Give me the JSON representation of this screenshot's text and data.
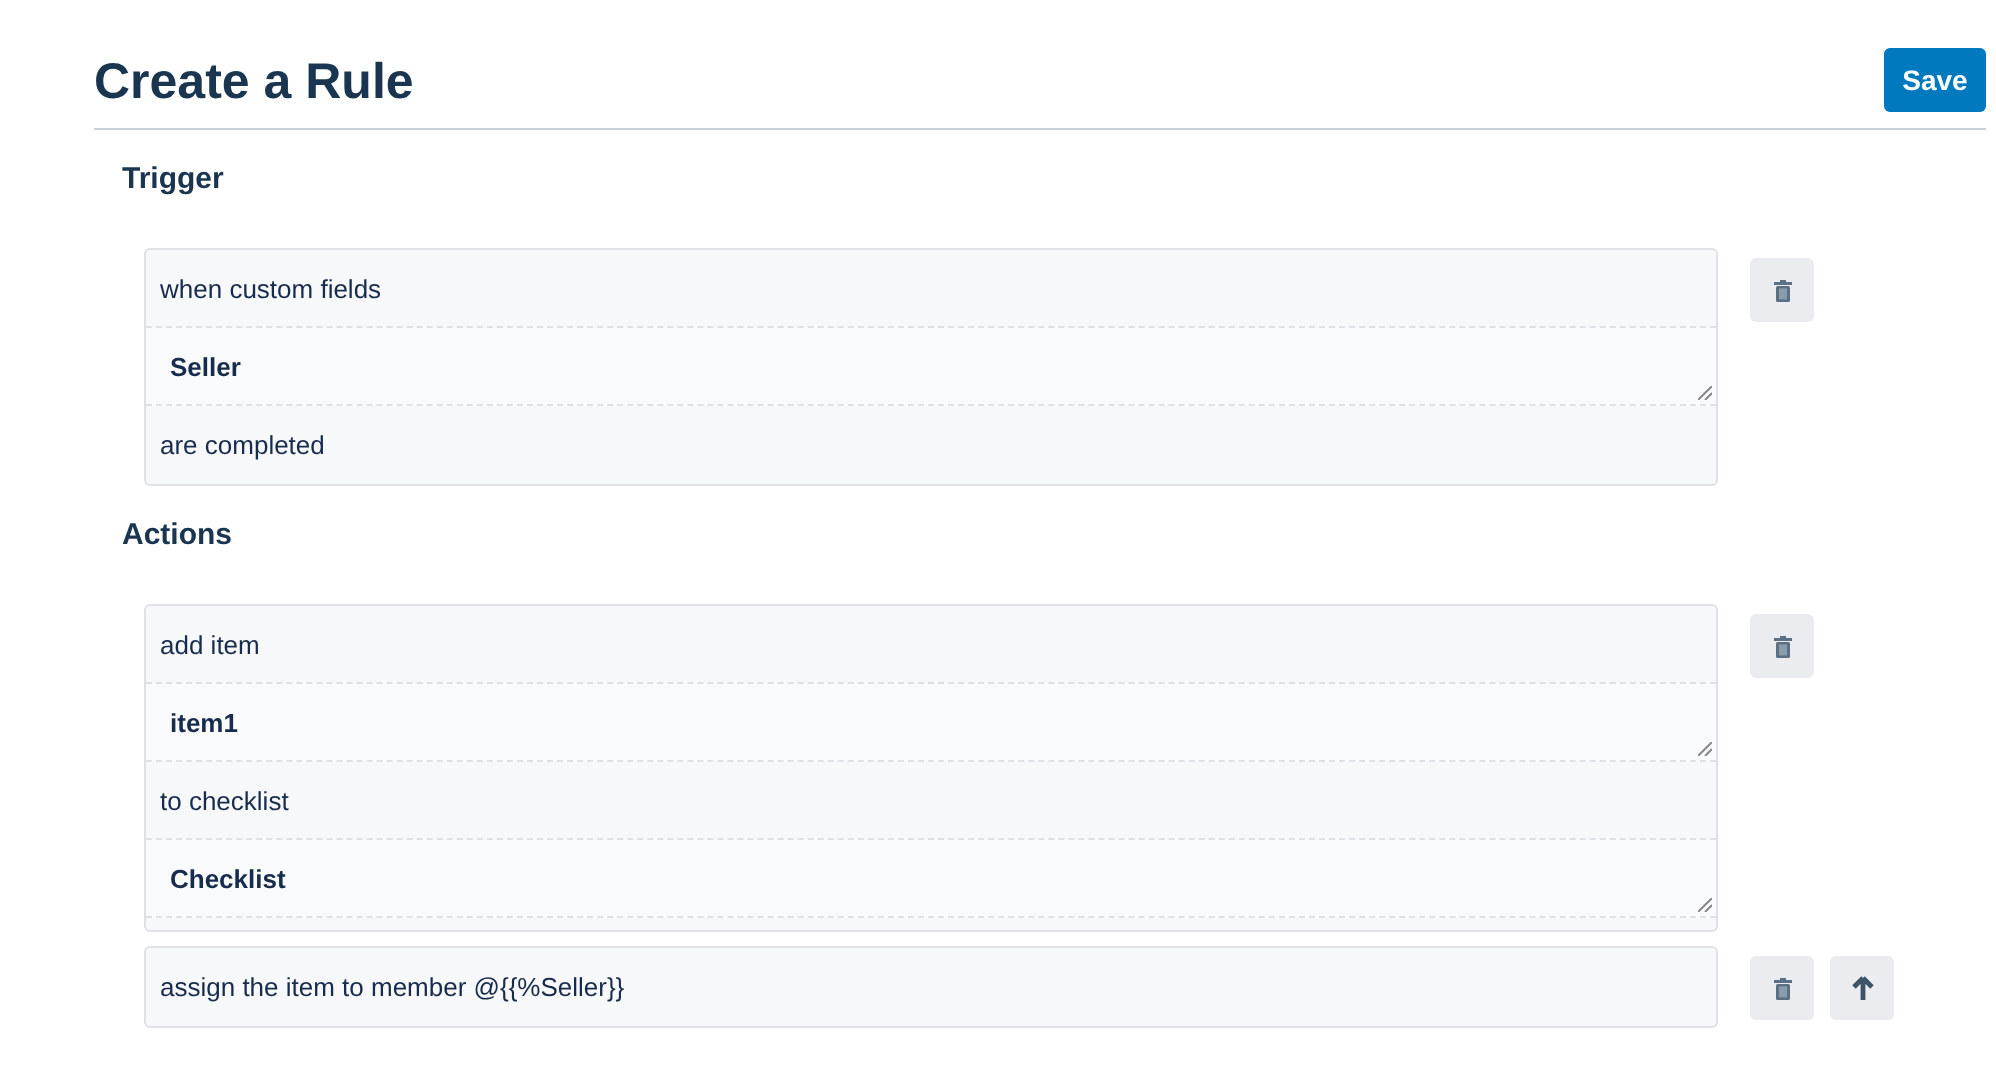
{
  "title": "Create a Rule",
  "save_button": "Save",
  "sections": [
    {
      "heading": "Trigger",
      "rules": [
        {
          "parts": [
            {
              "kind": "text",
              "text": "when custom fields"
            },
            {
              "kind": "field",
              "value": "Seller"
            },
            {
              "kind": "text",
              "text": "are completed"
            }
          ],
          "buttons": [
            {
              "kind": "delete"
            }
          ]
        }
      ]
    },
    {
      "heading": "Actions",
      "rules": [
        {
          "parts": [
            {
              "kind": "text",
              "text": "add item"
            },
            {
              "kind": "field",
              "value": "item1"
            },
            {
              "kind": "text",
              "text": "to checklist"
            },
            {
              "kind": "field",
              "value": "Checklist"
            }
          ],
          "buttons": [
            {
              "kind": "delete"
            }
          ]
        },
        {
          "parts": [
            {
              "kind": "text",
              "text": "assign the item to member @{{%Seller}}"
            }
          ],
          "buttons": [
            {
              "kind": "delete"
            },
            {
              "kind": "move_up"
            }
          ]
        }
      ]
    }
  ]
}
